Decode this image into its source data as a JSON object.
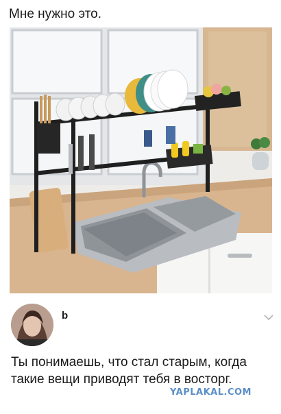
{
  "post": {
    "caption": "Мне нужно это.",
    "photo_subject": "kitchen-sink-dish-rack-photo",
    "author": {
      "name": "b",
      "avatar": "avatar-photo"
    },
    "text": "Ты понимаешь, что стал старым, когда такие вещи приводят тебя в восторг.",
    "menu_icon": "chevron-down-icon"
  },
  "watermark": {
    "text": "YAPLAKAL.COM"
  },
  "colors": {
    "text": "#1a1a1a",
    "watermark": "#5c8fc7",
    "wood": "#d9b894",
    "rack": "#1f1f1f",
    "steel": "#a9adb1"
  }
}
